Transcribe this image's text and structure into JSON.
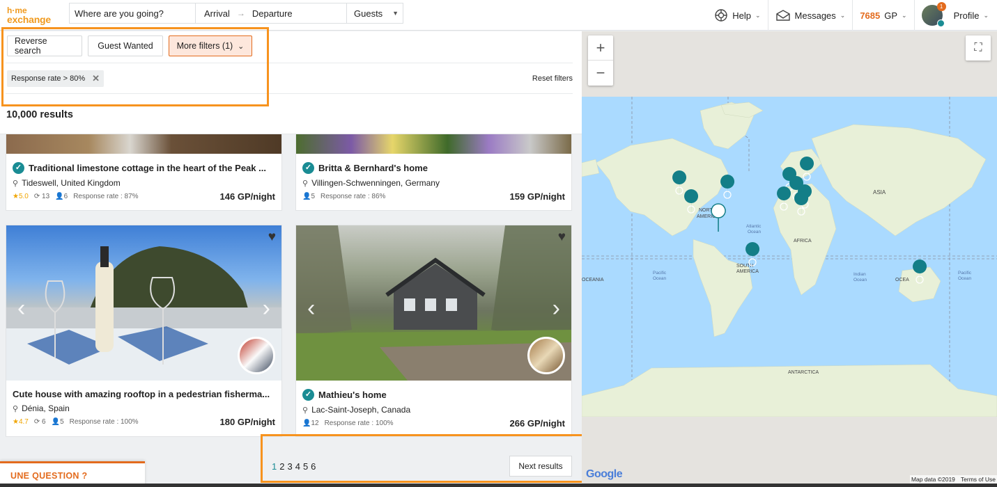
{
  "header": {
    "logo_top": "h·me",
    "logo_bottom": "exchange",
    "where_placeholder": "Where are you going?",
    "arrival": "Arrival",
    "arrow": "→",
    "departure": "Departure",
    "guests": "Guests",
    "help": "Help",
    "messages": "Messages",
    "gp_amount": "7685",
    "gp_unit": "GP",
    "profile": "Profile",
    "notif_count": "1"
  },
  "filters": {
    "reverse_search": "Reverse search",
    "guest_wanted": "Guest Wanted",
    "more_filters": "More filters (1)",
    "active_tag": "Response rate > 80%",
    "reset": "Reset filters",
    "results": "10,000 results"
  },
  "listings": [
    {
      "title": "Traditional limestone cottage in the heart of the Peak ...",
      "location": "Tideswell, United Kingdom",
      "rating": "5.0",
      "exchanges": "13",
      "guests": "6",
      "response": "Response rate : 87%",
      "price": "146 GP/night"
    },
    {
      "title": "Britta & Bernhard's home",
      "location": "Villingen-Schwenningen, Germany",
      "guests": "5",
      "response": "Response rate : 86%",
      "price": "159 GP/night"
    },
    {
      "title": "Cute house with amazing rooftop in a pedestrian fisherma...",
      "location": "Dénia, Spain",
      "rating": "4.7",
      "exchanges": "6",
      "guests": "5",
      "response": "Response rate : 100%",
      "price": "180 GP/night"
    },
    {
      "title": "Mathieu's home",
      "location": "Lac-Saint-Joseph, Canada",
      "guests": "12",
      "response": "Response rate : 100%",
      "price": "266 GP/night"
    }
  ],
  "pagination": {
    "pages": [
      "1",
      "2",
      "3",
      "4",
      "5",
      "6"
    ],
    "next": "Next results"
  },
  "question": "UNE QUESTION ?",
  "map": {
    "labels": {
      "asia": "ASIA",
      "north": "NORTH",
      "america": "AMERICA",
      "south": "SOUTH",
      "south_america": "AMERICA",
      "africa": "AFRICA",
      "atlantic": "Atlantic",
      "atlantic2": "Ocean",
      "pacific_l": "Pacific",
      "pacific_l2": "Ocean",
      "indian": "Indian",
      "indian2": "Ocean",
      "pacific_r": "Pacific",
      "pacific_r2": "Ocean",
      "oceania_l": "OCEANIA",
      "oceania_r": "OCEA",
      "antarctica": "ANTARCTICA"
    },
    "google": "Google",
    "map_data": "Map data ©2019",
    "terms": "Terms of Use",
    "zoom_in": "+",
    "zoom_out": "−"
  },
  "colors": {
    "accent": "#e36b1d",
    "teal": "#1a8c94",
    "highlight": "#f7931e",
    "water": "#aadaff",
    "land": "#e8f0d8"
  }
}
